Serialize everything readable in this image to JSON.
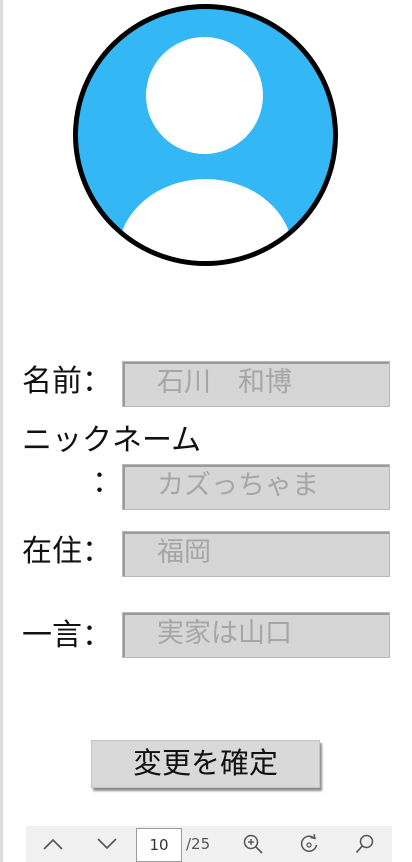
{
  "profile": {
    "fields": [
      {
        "label": "名前：",
        "value": "石川　和博"
      },
      {
        "label": "ニックネーム",
        "label_colon": "：",
        "value": "カズっちゃま"
      },
      {
        "label": "在住：",
        "value": "福岡"
      },
      {
        "label": "一言：",
        "value": "実家は山口"
      }
    ],
    "confirm_label": "変更を確定"
  },
  "viewer_toolbar": {
    "current_page": "10",
    "total_pages": "/25",
    "icons": [
      "chevron-up-icon",
      "chevron-down-icon",
      "zoom-in-icon",
      "rotate-icon",
      "search-icon"
    ]
  },
  "colors": {
    "avatar_bg": "#33b8f5",
    "avatar_border": "#000000",
    "field_bg": "#d6d6d6",
    "field_text": "#a6a6a6",
    "button_bg": "#d9d9d9"
  }
}
